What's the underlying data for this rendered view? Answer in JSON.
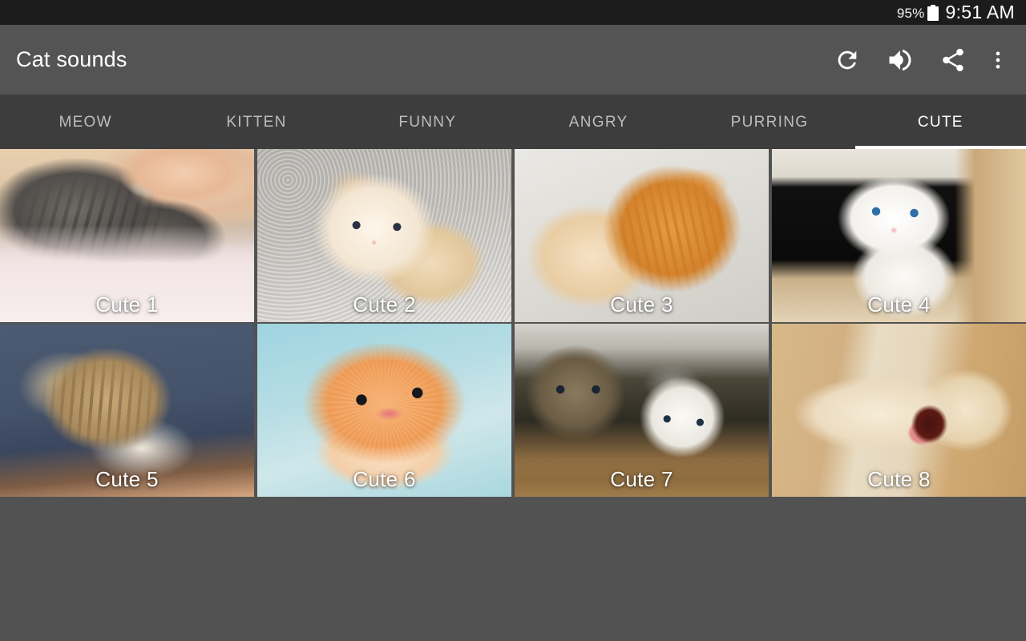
{
  "statusbar": {
    "battery_percent": "95%",
    "battery_icon": "battery-full-icon",
    "clock": "9:51 AM"
  },
  "appbar": {
    "title": "Cat sounds",
    "actions": [
      {
        "name": "refresh-button",
        "icon": "refresh-icon"
      },
      {
        "name": "volume-button",
        "icon": "volume-up-icon"
      },
      {
        "name": "share-button",
        "icon": "share-icon"
      },
      {
        "name": "overflow-menu-button",
        "icon": "more-vert-icon"
      }
    ]
  },
  "tabs": {
    "items": [
      {
        "label": "MEOW",
        "active": false
      },
      {
        "label": "KITTEN",
        "active": false
      },
      {
        "label": "FUNNY",
        "active": false
      },
      {
        "label": "ANGRY",
        "active": false
      },
      {
        "label": "PURRING",
        "active": false
      },
      {
        "label": "CUTE",
        "active": true
      }
    ],
    "selected": "CUTE"
  },
  "grid": {
    "columns": 4,
    "tiles": [
      {
        "label": "Cute 1"
      },
      {
        "label": "Cute 2"
      },
      {
        "label": "Cute 3"
      },
      {
        "label": "Cute 4"
      },
      {
        "label": "Cute 5"
      },
      {
        "label": "Cute 6"
      },
      {
        "label": "Cute 7"
      },
      {
        "label": "Cute 8"
      }
    ]
  },
  "colors": {
    "statusbar_bg": "#1c1c1c",
    "appbar_bg": "#545454",
    "tabbar_bg": "#3d3d3d",
    "page_bg": "#525252",
    "tab_active_indicator": "#ffffff",
    "tab_inactive_text": "#bdbdbd",
    "text_primary": "#ffffff"
  }
}
